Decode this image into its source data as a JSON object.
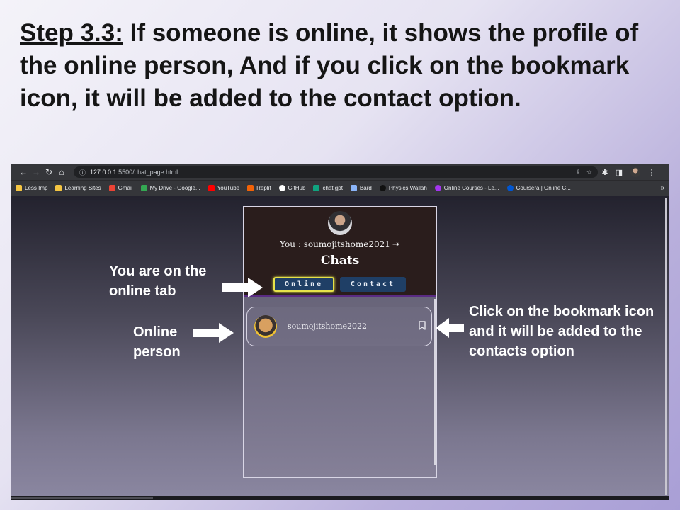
{
  "slide": {
    "step_label": "Step 3.3:",
    "title_text": " If someone is online, it shows the profile of the online person, And if you click on the bookmark icon, it will be added to the contact option."
  },
  "browser": {
    "url_host": "127.0.0.1",
    "url_path": ":5500/chat_page.html",
    "bookmarks": [
      {
        "label": "Less Imp",
        "icon": "folder-icon",
        "color": "#f4c542"
      },
      {
        "label": "Learning Sites",
        "icon": "folder-icon",
        "color": "#f4c542"
      },
      {
        "label": "Gmail",
        "icon": "gmail-icon",
        "color": "#ea4335"
      },
      {
        "label": "My Drive - Google...",
        "icon": "drive-icon",
        "color": "#34a853"
      },
      {
        "label": "YouTube",
        "icon": "youtube-icon",
        "color": "#ff0000"
      },
      {
        "label": "Replit",
        "icon": "replit-icon",
        "color": "#f26207"
      },
      {
        "label": "GitHub",
        "icon": "github-icon",
        "color": "#ffffff"
      },
      {
        "label": "chat gpt",
        "icon": "chatgpt-icon",
        "color": "#10a37f"
      },
      {
        "label": "Bard",
        "icon": "bard-icon",
        "color": "#8ab4f8"
      },
      {
        "label": "Physics Wallah",
        "icon": "pw-icon",
        "color": "#111111"
      },
      {
        "label": "Online Courses - Le...",
        "icon": "udemy-icon",
        "color": "#a435f0"
      },
      {
        "label": "Coursera | Online C...",
        "icon": "coursera-icon",
        "color": "#0056d2"
      }
    ],
    "more_label": "»"
  },
  "chat": {
    "you_prefix": "You : ",
    "username": "soumojitshome2021",
    "logout_glyph": "⇥",
    "title": "Chats",
    "tab_online": "Online",
    "tab_contact": "Contact",
    "online_user": "soumojitshome2022"
  },
  "annotations": {
    "online_tab": "You are on the online tab",
    "online_person": "Online person",
    "bookmark": "Click on the bookmark icon and it will be added to the contacts option"
  },
  "colors": {
    "accent_highlight": "#e6e24a",
    "tab_bg": "#1f3f66",
    "header_bg": "#2a1d1c",
    "header_border": "#5a2b83"
  }
}
